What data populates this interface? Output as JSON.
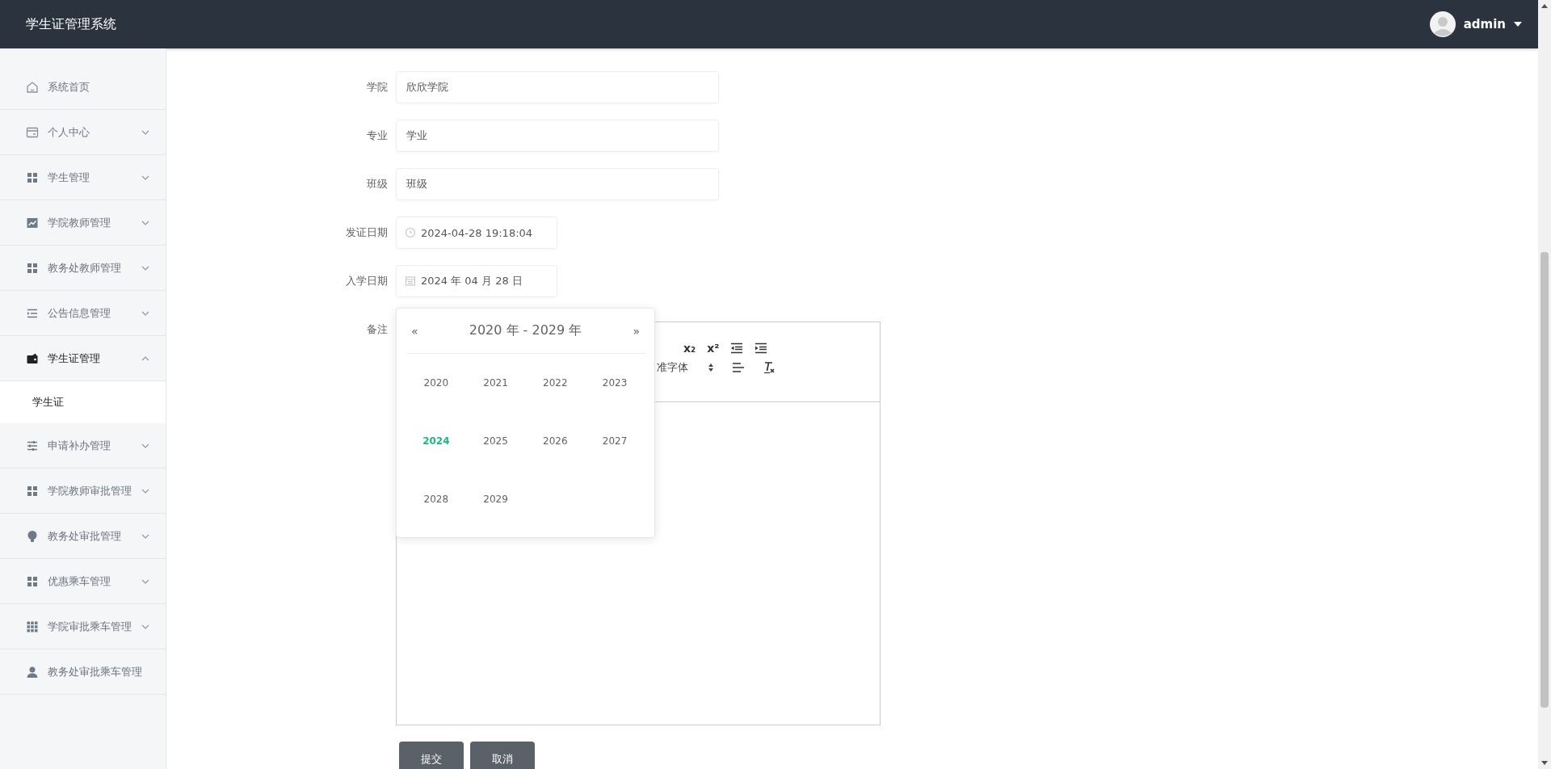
{
  "header": {
    "title": "学生证管理系统",
    "user": {
      "name": "admin"
    }
  },
  "sidebar": {
    "items": [
      {
        "label": "系统首页",
        "kind": "link"
      },
      {
        "label": "个人中心",
        "kind": "menu",
        "expanded": false
      },
      {
        "label": "学生管理",
        "kind": "menu",
        "expanded": false
      },
      {
        "label": "学院教师管理",
        "kind": "menu",
        "expanded": false
      },
      {
        "label": "教务处教师管理",
        "kind": "menu",
        "expanded": false
      },
      {
        "label": "公告信息管理",
        "kind": "menu",
        "expanded": false
      },
      {
        "label": "学生证管理",
        "kind": "menu",
        "expanded": true,
        "children": [
          {
            "label": "学生证",
            "selected": true
          }
        ]
      },
      {
        "label": "申请补办管理",
        "kind": "menu",
        "expanded": false
      },
      {
        "label": "学院教师审批管理",
        "kind": "menu",
        "expanded": false
      },
      {
        "label": "教务处审批管理",
        "kind": "menu",
        "expanded": false
      },
      {
        "label": "优惠乘车管理",
        "kind": "menu",
        "expanded": false
      },
      {
        "label": "学院审批乘车管理",
        "kind": "menu",
        "expanded": false
      },
      {
        "label": "教务处审批乘车管理",
        "kind": "link"
      }
    ]
  },
  "form": {
    "fields": [
      {
        "label": "学院",
        "value": "欣欣学院",
        "kind": "text"
      },
      {
        "label": "专业",
        "value": "学业",
        "kind": "text"
      },
      {
        "label": "班级",
        "value": "班级",
        "kind": "text"
      },
      {
        "label": "发证日期",
        "value": "2024-04-28 19:18:04",
        "kind": "datetime"
      },
      {
        "label": "入学日期",
        "value": "2024 年 04 月 28 日",
        "kind": "date"
      }
    ],
    "remark": {
      "label": "备注",
      "toolbar": {
        "subscript": "x₂",
        "superscript": "x²",
        "font": "准字体"
      }
    },
    "year_picker": {
      "range": "2020 年 - 2029 年",
      "prev": "«",
      "next": "»",
      "years": [
        {
          "label": "2020",
          "selected": false
        },
        {
          "label": "2021",
          "selected": false
        },
        {
          "label": "2022",
          "selected": false
        },
        {
          "label": "2023",
          "selected": false
        },
        {
          "label": "2024",
          "selected": true
        },
        {
          "label": "2025",
          "selected": false
        },
        {
          "label": "2026",
          "selected": false
        },
        {
          "label": "2027",
          "selected": false
        },
        {
          "label": "2028",
          "selected": false
        },
        {
          "label": "2029",
          "selected": false
        }
      ]
    },
    "buttons": [
      {
        "label": "提交"
      },
      {
        "label": "取消"
      }
    ]
  }
}
